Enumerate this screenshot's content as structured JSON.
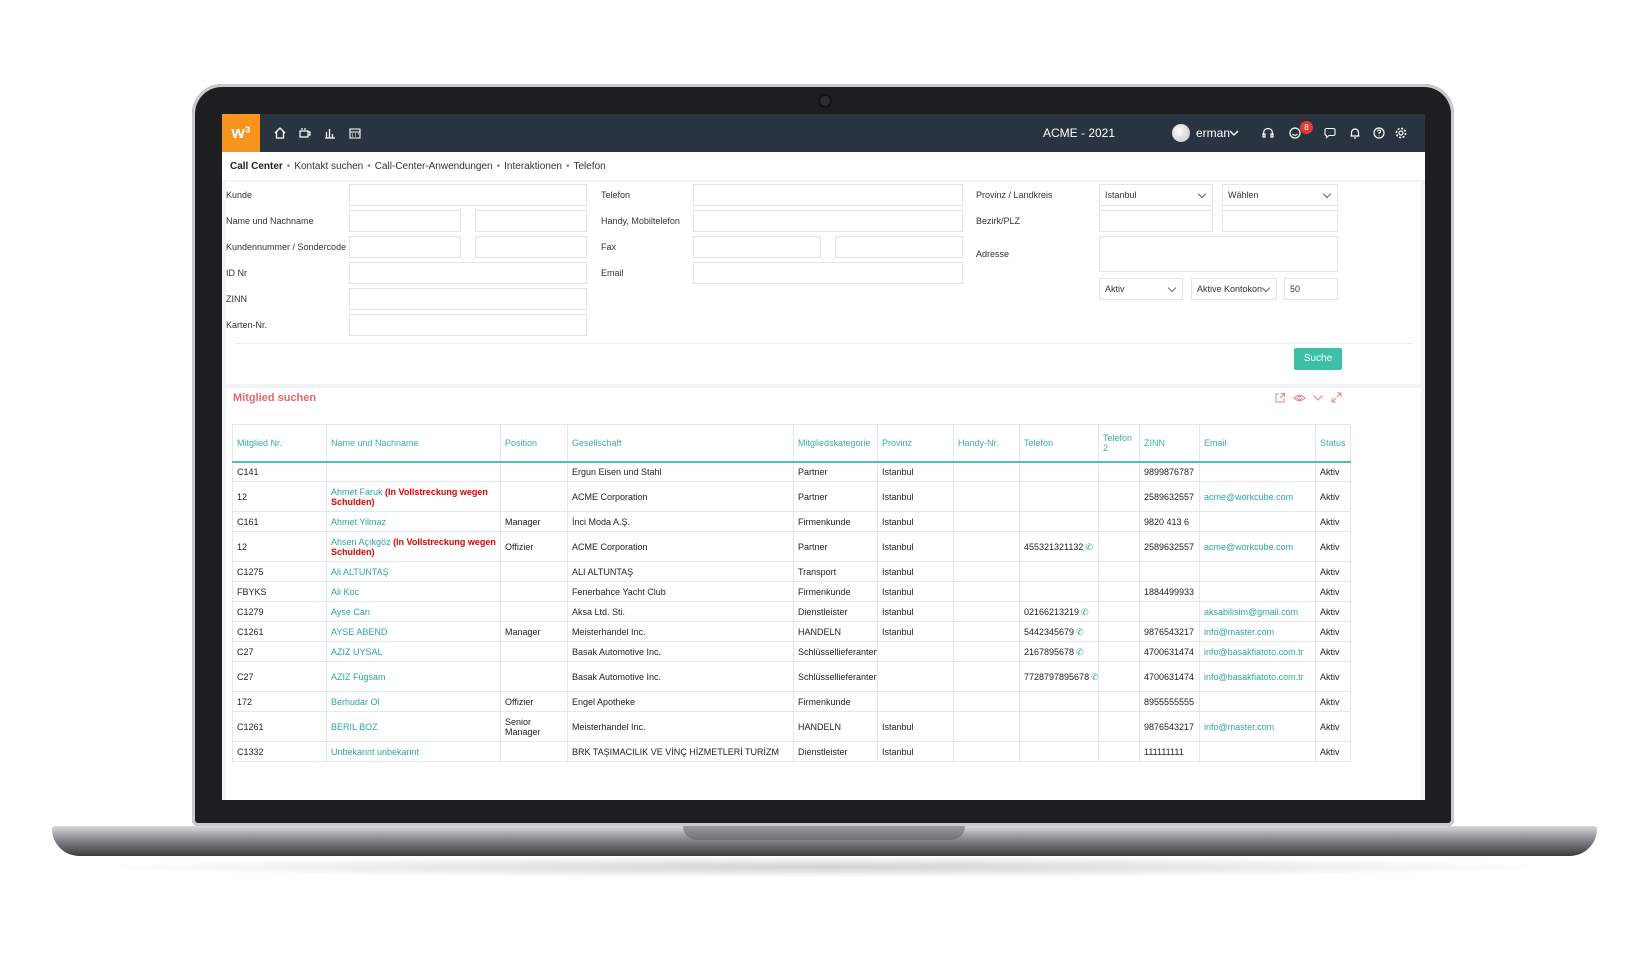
{
  "topbar": {
    "logo": "w³",
    "company": "ACME - 2021",
    "user": "erman",
    "notification_count": "8"
  },
  "breadcrumb": {
    "items": [
      "Call Center",
      "Kontakt suchen",
      "Call-Center-Anwendungen",
      "Interaktionen",
      "Telefon"
    ]
  },
  "form": {
    "kunde_label": "Kunde",
    "name_label": "Name und Nachname",
    "kundennummer_label": "Kundennummer / Sondercode",
    "id_label": "ID Nr",
    "zinn_label": "ZINN",
    "karten_label": "Karten-Nr.",
    "telefon_label": "Telefon",
    "handy_label": "Handy, Mobiltelefon",
    "fax_label": "Fax",
    "email_label": "Email",
    "provinz_label": "Provinz / Landkreis",
    "bezirk_label": "Bezirk/PLZ",
    "adresse_label": "Adresse",
    "provinz_value": "Istanbul",
    "bezirk_select": "Wählen",
    "status_select": "Aktiv",
    "konto_select": "Aktive Kontokon",
    "limit_value": "50",
    "search_button": "Suche"
  },
  "results": {
    "title": "Mitglied suchen",
    "columns": [
      "Mitglied Nr.",
      "Name und Nachname",
      "Position",
      "Gesellschaft",
      "Mitgliedskategorie",
      "Provinz",
      "Handy-Nr.",
      "Telefon",
      "Telefon 2",
      "ZINN",
      "Email",
      "Status"
    ],
    "rows": [
      {
        "nr": "C141",
        "name": "",
        "warn": "",
        "position": "",
        "company": "Ergun Eisen und Stahl",
        "category": "Partner",
        "province": "Istanbul",
        "handy": "",
        "phone": "",
        "phone2": "",
        "zinn": "9899876787",
        "email": "",
        "status": "Aktiv"
      },
      {
        "nr": "12",
        "name": "Ahmet Faruk",
        "warn": "(In Vollstreckung wegen Schulden)",
        "position": "",
        "company": "ACME Corporation",
        "category": "Partner",
        "province": "Istanbul",
        "handy": "",
        "phone": "",
        "phone2": "",
        "zinn": "2589632557",
        "email": "acme@workcube.com",
        "status": "Aktiv"
      },
      {
        "nr": "C161",
        "name": "Ahmet Yilmaz",
        "warn": "",
        "position": "Manager",
        "company": "İnci Moda A.Ş.",
        "category": "Firmenkunde",
        "province": "Istanbul",
        "handy": "",
        "phone": "",
        "phone2": "",
        "zinn": "9820 413 6",
        "email": "",
        "status": "Aktiv"
      },
      {
        "nr": "12",
        "name": "Ahsen Açıkgöz",
        "warn": "(In Vollstreckung wegen Schulden)",
        "position": "Offizier",
        "company": "ACME Corporation",
        "category": "Partner",
        "province": "Istanbul",
        "handy": "",
        "phone": "455321321132",
        "phone2": "",
        "zinn": "2589632557",
        "email": "acme@workcube.com",
        "status": "Aktiv"
      },
      {
        "nr": "C1275",
        "name": "Ali ALTUNTAŞ",
        "warn": "",
        "position": "",
        "company": "ALI ALTUNTAŞ",
        "category": "Transport",
        "province": "Istanbul",
        "handy": "",
        "phone": "",
        "phone2": "",
        "zinn": "",
        "email": "",
        "status": "Aktiv"
      },
      {
        "nr": "FBYKS",
        "name": "Ali Koc",
        "warn": "",
        "position": "",
        "company": "Fenerbahce Yacht Club",
        "category": "Firmenkunde",
        "province": "Istanbul",
        "handy": "",
        "phone": "",
        "phone2": "",
        "zinn": "1884499933",
        "email": "",
        "status": "Aktiv"
      },
      {
        "nr": "C1279",
        "name": "Ayse Can",
        "warn": "",
        "position": "",
        "company": "Aksa Ltd. Sti.",
        "category": "Dienstleister",
        "province": "Istanbul",
        "handy": "",
        "phone": "02166213219",
        "phone2": "",
        "zinn": "",
        "email": "aksabilisim@gmail.com",
        "status": "Aktiv"
      },
      {
        "nr": "C1261",
        "name": "AYSE ABEND",
        "warn": "",
        "position": "Manager",
        "company": "Meisterhandel Inc.",
        "category": "HANDELN",
        "province": "Istanbul",
        "handy": "",
        "phone": "5442345679",
        "phone2": "",
        "zinn": "9876543217",
        "email": "info@master.com",
        "status": "Aktiv"
      },
      {
        "nr": "C27",
        "name": "AZIZ UYSAL",
        "warn": "",
        "position": "",
        "company": "Basak Automotive Inc.",
        "category": "Schlüssellieferanten",
        "province": "",
        "handy": "",
        "phone": "2167895678",
        "phone2": "",
        "zinn": "4700631474",
        "email": "info@basakfiatoto.com.tr",
        "status": "Aktiv"
      },
      {
        "nr": "C27",
        "name": "AZIZ Fügsam",
        "warn": "",
        "position": "",
        "company": "Basak Automotive Inc.",
        "category": "Schlüssellieferanten",
        "province": "",
        "handy": "",
        "phone": "7728797895678",
        "phone2": "",
        "zinn": "4700631474",
        "email": "info@basakfiatoto.com.tr",
        "status": "Aktiv"
      },
      {
        "nr": "172",
        "name": "Berhudar Ol",
        "warn": "",
        "position": "Offizier",
        "company": "Engel Apotheke",
        "category": "Firmenkunde",
        "province": "",
        "handy": "",
        "phone": "",
        "phone2": "",
        "zinn": "8955555555",
        "email": "",
        "status": "Aktiv"
      },
      {
        "nr": "C1261",
        "name": "BERIL BOZ",
        "warn": "",
        "position": "Senior Manager",
        "company": "Meisterhandel Inc.",
        "category": "HANDELN",
        "province": "Istanbul",
        "handy": "",
        "phone": "",
        "phone2": "",
        "zinn": "9876543217",
        "email": "info@master.com",
        "status": "Aktiv"
      },
      {
        "nr": "C1332",
        "name": "Unbekannt unbekannt",
        "warn": "",
        "position": "",
        "company": "BRK TAŞIMACILIK VE VİNÇ HİZMETLERİ TURİZM",
        "category": "Dienstleister",
        "province": "Istanbul",
        "handy": "",
        "phone": "",
        "phone2": "",
        "zinn": "111111111",
        "email": "",
        "status": "Aktiv"
      }
    ]
  }
}
